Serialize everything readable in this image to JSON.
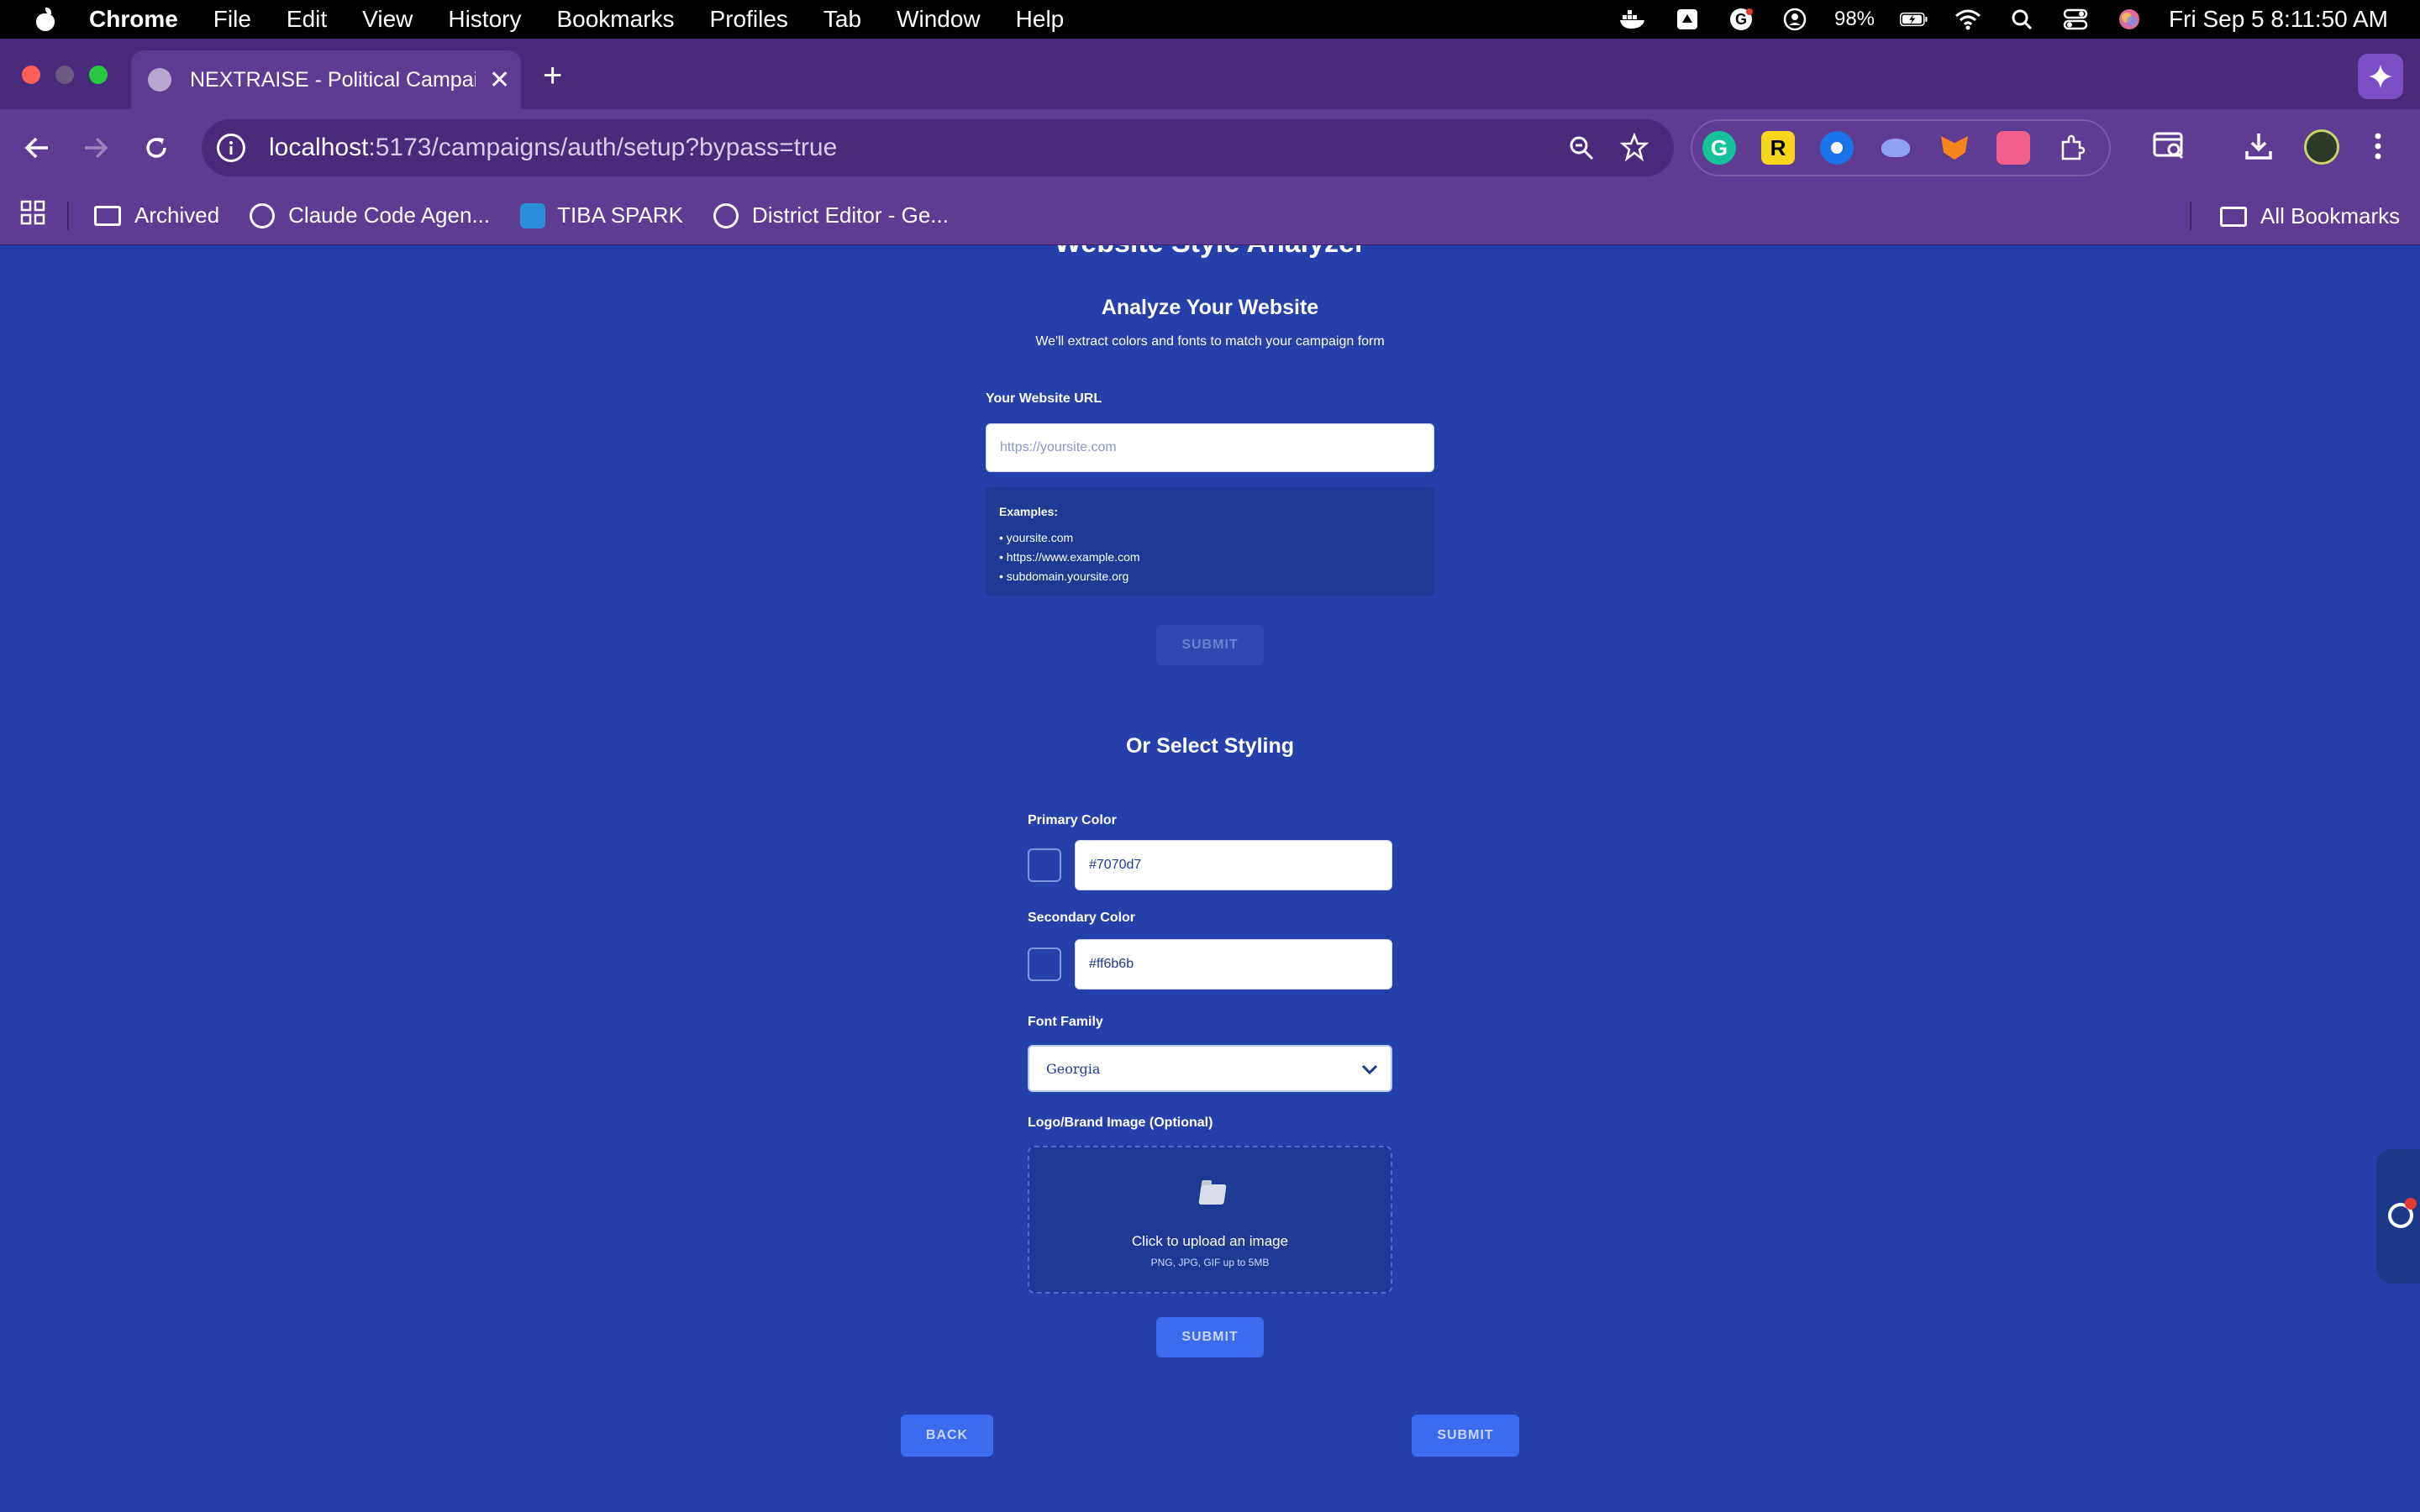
{
  "menubar": {
    "app_name": "Chrome",
    "items": [
      "File",
      "Edit",
      "View",
      "History",
      "Bookmarks",
      "Profiles",
      "Tab",
      "Window",
      "Help"
    ],
    "battery": "98%",
    "datetime": "Fri Sep 5  8:11:50 AM"
  },
  "browser": {
    "tab_title": "NEXTRAISE - Political Campaign",
    "url_host": "localhost",
    "url_path": ":5173/campaigns/auth/setup?bypass=true",
    "extension_r_label": "R",
    "bookmarks": [
      {
        "label": "Archived",
        "icon": "folder-icon"
      },
      {
        "label": "Claude Code Agen...",
        "icon": "globe-icon"
      },
      {
        "label": "TIBA SPARK",
        "icon": "tiba-icon"
      },
      {
        "label": "District Editor - Ge...",
        "icon": "globe-icon"
      }
    ],
    "all_bookmarks": "All Bookmarks"
  },
  "page": {
    "partial_title": "Website Style Analyzer",
    "analyze": {
      "heading": "Analyze Your Website",
      "subheading": "We'll extract colors and fonts to match your campaign form",
      "url_label": "Your Website URL",
      "url_placeholder": "https://yoursite.com",
      "examples_title": "Examples:",
      "examples": [
        "• yoursite.com",
        "• https://www.example.com",
        "• subdomain.yoursite.org"
      ],
      "submit_label": "SUBMIT"
    },
    "styling": {
      "heading": "Or Select Styling",
      "primary_label": "Primary Color",
      "primary_value": "#7070d7",
      "secondary_label": "Secondary Color",
      "secondary_value": "#ff6b6b",
      "font_label": "Font Family",
      "font_value": "Georgia",
      "logo_label": "Logo/Brand Image (Optional)",
      "upload_text": "Click to upload an image",
      "upload_hint": "PNG, JPG, GIF up to 5MB",
      "submit_label": "SUBMIT"
    },
    "nav": {
      "back_label": "BACK",
      "submit_label": "SUBMIT"
    }
  },
  "colors": {
    "page_bg": "#2540a8",
    "chrome_frame": "#4a2a7c",
    "chrome_toolbar": "#5f3c93",
    "button_primary": "#3b6cf0"
  }
}
